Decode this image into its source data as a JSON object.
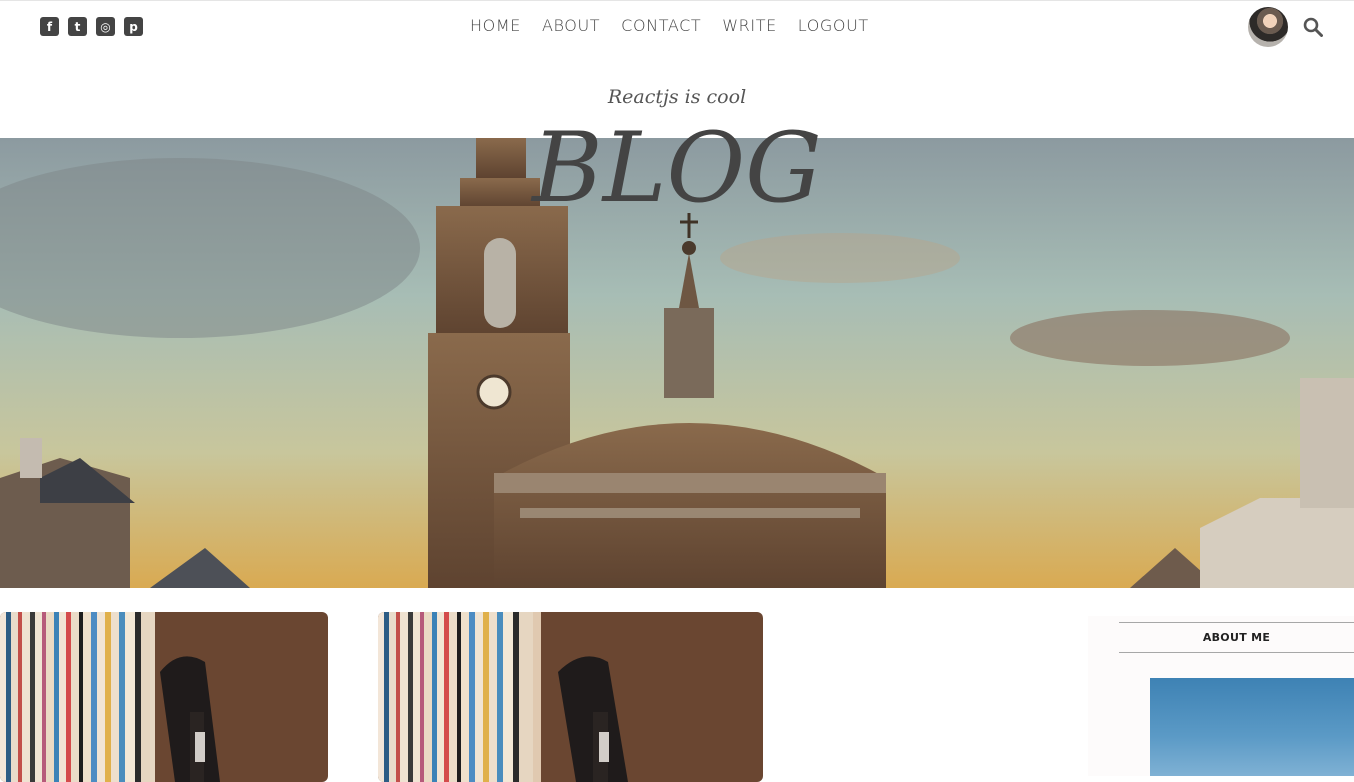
{
  "nav": {
    "links": [
      "HOME",
      "ABOUT",
      "CONTACT",
      "WRITE",
      "LOGOUT"
    ]
  },
  "social_icons": [
    "facebook-icon",
    "twitter-icon",
    "instagram-icon",
    "pinterest-icon"
  ],
  "header": {
    "subtitle": "Reactjs is cool",
    "title": "BLOG"
  },
  "sidebar": {
    "title": "ABOUT ME"
  },
  "colors": {
    "text": "#444444",
    "sidebar_bg": "#fdfbfb"
  }
}
